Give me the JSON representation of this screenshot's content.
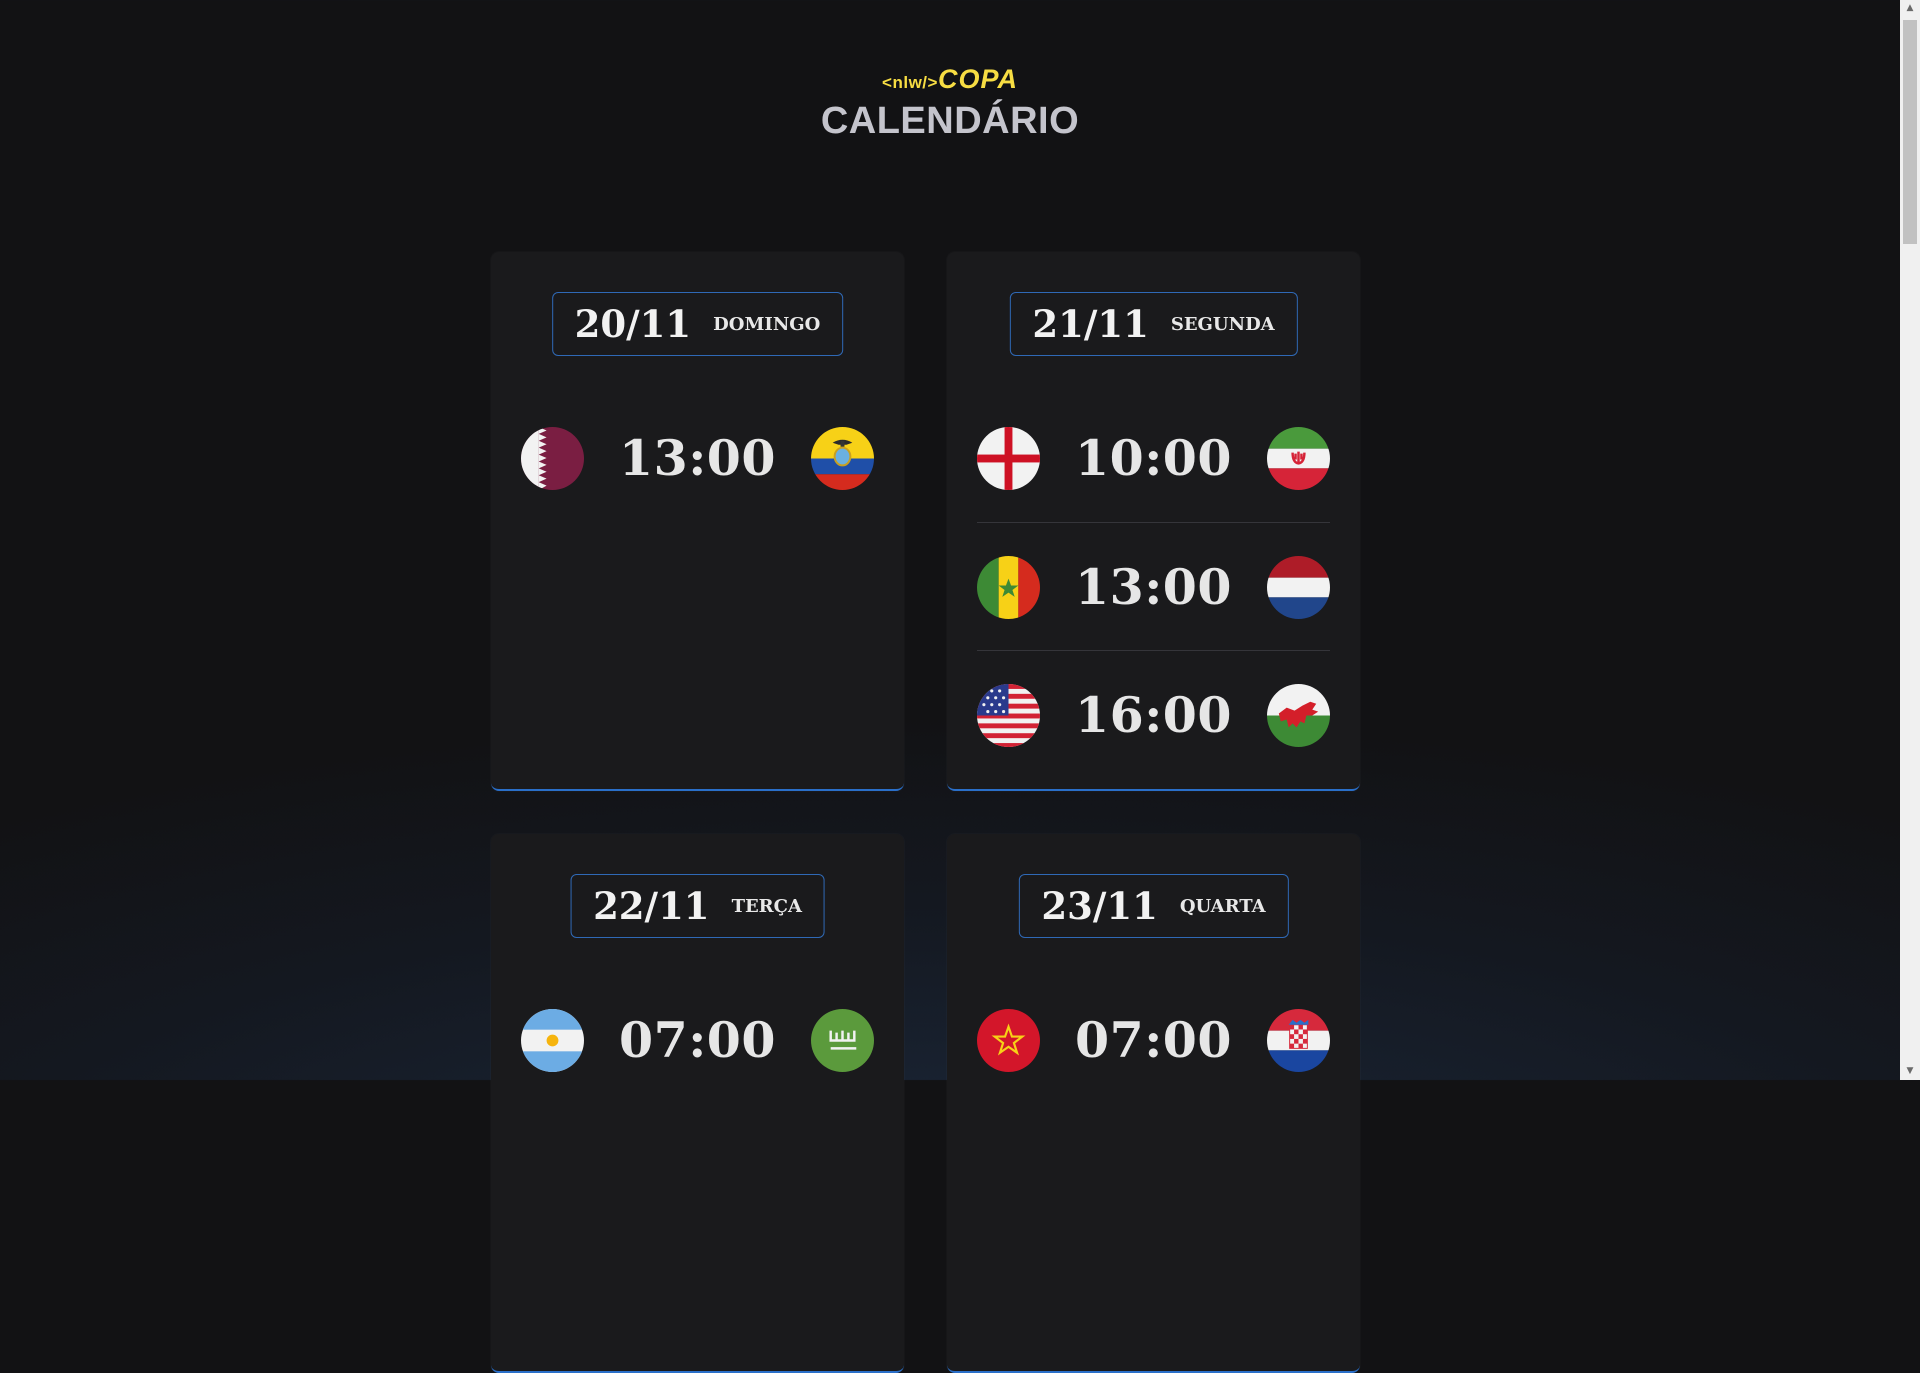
{
  "header": {
    "logo_tag": "<nlw/>",
    "logo_copa": "COPA",
    "title": "CALENDÁRIO"
  },
  "colors": {
    "accent": "#2f69b6",
    "logo": "#f7dd43",
    "background": "#121214",
    "card": "#1a1a1c"
  },
  "days": [
    {
      "date": "20/11",
      "weekday": "DOMINGO",
      "games": [
        {
          "home": "qatar-flag",
          "time": "13:00",
          "away": "ecuador-flag"
        }
      ]
    },
    {
      "date": "21/11",
      "weekday": "SEGUNDA",
      "games": [
        {
          "home": "england-flag",
          "time": "10:00",
          "away": "iran-flag"
        },
        {
          "home": "senegal-flag",
          "time": "13:00",
          "away": "netherlands-flag"
        },
        {
          "home": "usa-flag",
          "time": "16:00",
          "away": "wales-flag"
        }
      ]
    },
    {
      "date": "22/11",
      "weekday": "TERÇA",
      "games": [
        {
          "home": "argentina-flag",
          "time": "07:00",
          "away": "saudi-arabia-flag"
        }
      ]
    },
    {
      "date": "23/11",
      "weekday": "QUARTA",
      "games": [
        {
          "home": "morocco-flag",
          "time": "07:00",
          "away": "croatia-flag"
        }
      ]
    }
  ]
}
